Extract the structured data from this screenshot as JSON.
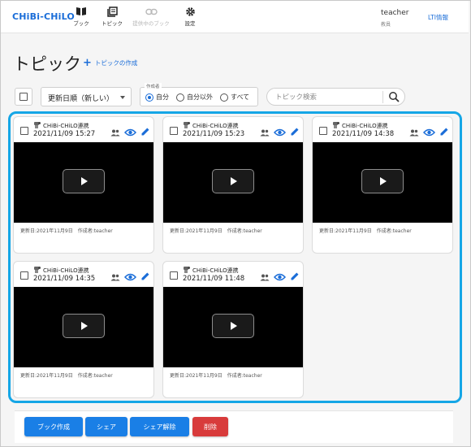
{
  "header": {
    "logo": "CHiBi-CHiLO",
    "nav": [
      {
        "label": "ブック",
        "icon": "book-icon",
        "disabled": false
      },
      {
        "label": "トピック",
        "icon": "topic-icon",
        "disabled": false
      },
      {
        "label": "提供中のブック",
        "icon": "link-icon",
        "disabled": true
      },
      {
        "label": "設定",
        "icon": "gear-icon",
        "disabled": false
      }
    ],
    "user_name": "teacher",
    "user_role": "教員",
    "lti_link": "LTI情報"
  },
  "page": {
    "title": "トピック",
    "create_label": "トピックの作成"
  },
  "toolbar": {
    "sort_value": "更新日順（新しい）",
    "author_legend": "作成者",
    "author_options": [
      {
        "label": "自分",
        "selected": true
      },
      {
        "label": "自分以外",
        "selected": false
      },
      {
        "label": "すべて",
        "selected": false
      }
    ],
    "search_placeholder": "トピック検索"
  },
  "cards": [
    {
      "title": "CHiBi-CHiLO連携",
      "date": "2021/11/09 15:27",
      "meta": "更新日:2021年11月9日　作成者:teacher"
    },
    {
      "title": "CHiBi-CHiLO連携",
      "date": "2021/11/09 15:23",
      "meta": "更新日:2021年11月9日　作成者:teacher"
    },
    {
      "title": "CHiBi-CHiLO連携",
      "date": "2021/11/09 14:38",
      "meta": "更新日:2021年11月9日　作成者:teacher"
    },
    {
      "title": "CHiBi-CHiLO連携",
      "date": "2021/11/09 14:35",
      "meta": "更新日:2021年11月9日　作成者:teacher"
    },
    {
      "title": "CHiBi-CHiLO連携",
      "date": "2021/11/09 11:48",
      "meta": "更新日:2021年11月9日　作成者:teacher"
    }
  ],
  "actions": {
    "create_book": "ブック作成",
    "share": "シェア",
    "unshare": "シェア解除",
    "delete": "削除"
  },
  "colors": {
    "accent": "#1a6dd8",
    "highlight_border": "#15a6e6",
    "button_blue": "#1a7fe6",
    "button_red": "#d83b3b"
  }
}
